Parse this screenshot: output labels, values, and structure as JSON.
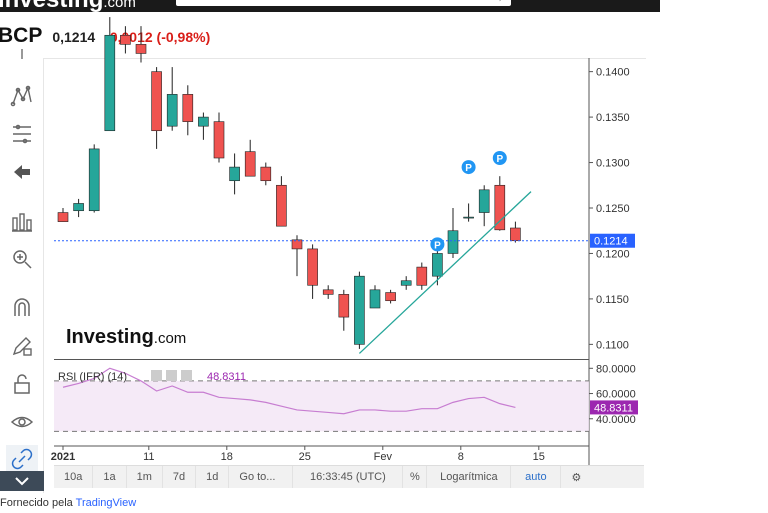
{
  "topbar": {
    "logo": "investing",
    "logo_suffix": ".com"
  },
  "quote": {
    "symbol": "BCP",
    "price": "0,1214",
    "change": "-0,0012 (-0,98%)"
  },
  "watermark": {
    "brand": "Investing",
    "suffix": ".com"
  },
  "price_axis": {
    "ticks": [
      "0.1400",
      "0.1350",
      "0.1300",
      "0.1250",
      "0.1200",
      "0.1150",
      "0.1100"
    ],
    "last_price_label": "0.1214"
  },
  "rsi": {
    "label": "RSI (IFR) (14)",
    "value": "48.8311",
    "axis_ticks": [
      "80.0000",
      "60.0000",
      "40.0000"
    ],
    "value_label": "48.8311"
  },
  "time_axis": {
    "ticks": [
      "2021",
      "11",
      "18",
      "25",
      "Fev",
      "8",
      "15"
    ]
  },
  "bottom_bar": {
    "items": [
      "10a",
      "1a",
      "1m",
      "7d",
      "1d",
      "Go to..."
    ],
    "time": "16:33:45 (UTC)",
    "percent": "%",
    "log": "Logarítmica",
    "auto": "auto"
  },
  "footer": {
    "prefix": "Fornecido pela",
    "link": "TradingView"
  },
  "colors": {
    "up": "#26a69a",
    "down": "#ef5350",
    "rsi": "#9c27b0",
    "last_price": "#2962ff"
  },
  "chart_data": {
    "type": "candlestick",
    "y_range": [
      0.1085,
      0.1415
    ],
    "candles": [
      {
        "o": 0.1245,
        "h": 0.125,
        "l": 0.1235,
        "c": 0.1235
      },
      {
        "o": 0.1247,
        "h": 0.126,
        "l": 0.124,
        "c": 0.1255
      },
      {
        "o": 0.1247,
        "h": 0.132,
        "l": 0.1245,
        "c": 0.1315
      },
      {
        "o": 0.1335,
        "h": 0.146,
        "l": 0.1335,
        "c": 0.144
      },
      {
        "o": 0.144,
        "h": 0.145,
        "l": 0.142,
        "c": 0.143
      },
      {
        "o": 0.143,
        "h": 0.145,
        "l": 0.141,
        "c": 0.142
      },
      {
        "o": 0.14,
        "h": 0.1405,
        "l": 0.1315,
        "c": 0.1335
      },
      {
        "o": 0.134,
        "h": 0.1405,
        "l": 0.1335,
        "c": 0.1375
      },
      {
        "o": 0.1375,
        "h": 0.1385,
        "l": 0.133,
        "c": 0.1345
      },
      {
        "o": 0.134,
        "h": 0.1355,
        "l": 0.1325,
        "c": 0.135
      },
      {
        "o": 0.1345,
        "h": 0.1355,
        "l": 0.13,
        "c": 0.1305
      },
      {
        "o": 0.128,
        "h": 0.131,
        "l": 0.1265,
        "c": 0.1295
      },
      {
        "o": 0.1312,
        "h": 0.1325,
        "l": 0.1285,
        "c": 0.1285
      },
      {
        "o": 0.1295,
        "h": 0.13,
        "l": 0.1275,
        "c": 0.128
      },
      {
        "o": 0.1275,
        "h": 0.1285,
        "l": 0.123,
        "c": 0.123
      },
      {
        "o": 0.1215,
        "h": 0.122,
        "l": 0.1175,
        "c": 0.1205
      },
      {
        "o": 0.1205,
        "h": 0.121,
        "l": 0.115,
        "c": 0.1165
      },
      {
        "o": 0.116,
        "h": 0.1165,
        "l": 0.115,
        "c": 0.1155
      },
      {
        "o": 0.1155,
        "h": 0.116,
        "l": 0.1115,
        "c": 0.113
      },
      {
        "o": 0.11,
        "h": 0.118,
        "l": 0.1095,
        "c": 0.1175
      },
      {
        "o": 0.114,
        "h": 0.1165,
        "l": 0.114,
        "c": 0.116
      },
      {
        "o": 0.1157,
        "h": 0.116,
        "l": 0.1145,
        "c": 0.1148
      },
      {
        "o": 0.1165,
        "h": 0.1175,
        "l": 0.116,
        "c": 0.117
      },
      {
        "o": 0.1185,
        "h": 0.119,
        "l": 0.116,
        "c": 0.1165
      },
      {
        "o": 0.1175,
        "h": 0.1205,
        "l": 0.1165,
        "c": 0.12
      },
      {
        "o": 0.12,
        "h": 0.125,
        "l": 0.1195,
        "c": 0.1225
      },
      {
        "o": 0.124,
        "h": 0.1255,
        "l": 0.1235,
        "c": 0.124
      },
      {
        "o": 0.1245,
        "h": 0.1275,
        "l": 0.123,
        "c": 0.127
      },
      {
        "o": 0.1275,
        "h": 0.1285,
        "l": 0.1225,
        "c": 0.1226
      },
      {
        "o": 0.1228,
        "h": 0.1235,
        "l": 0.1212,
        "c": 0.1214
      }
    ],
    "pivot_markers": [
      {
        "index": 24,
        "value": 0.121,
        "label": "P"
      },
      {
        "index": 26,
        "value": 0.1295,
        "label": "P"
      },
      {
        "index": 28,
        "value": 0.1305,
        "label": "P"
      }
    ],
    "trendline": {
      "from": {
        "index": 19,
        "value": 0.109
      },
      "to": {
        "index": 30,
        "value": 0.1268
      }
    },
    "last_price": 0.1214,
    "rsi_range": [
      20,
      85
    ],
    "rsi_levels": [
      70,
      30
    ],
    "rsi_values": [
      65,
      68,
      72,
      80,
      76,
      70,
      62,
      66,
      61,
      61,
      57,
      56,
      55,
      53,
      50,
      47,
      46,
      45,
      44,
      47,
      47,
      46,
      46,
      48,
      48,
      53,
      56,
      57,
      52,
      49
    ]
  }
}
